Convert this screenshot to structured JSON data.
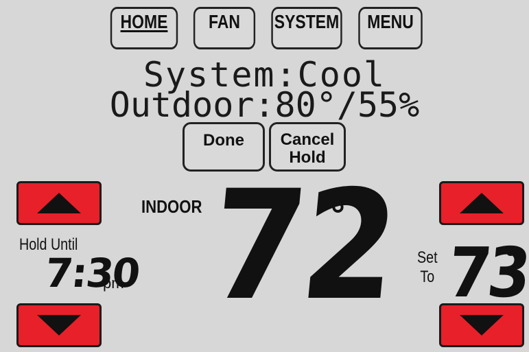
{
  "tabs": {
    "home": "HOME",
    "fan": "FAN",
    "system": "SYSTEM",
    "menu": "MENU"
  },
  "status": {
    "system_line": "System:Cool",
    "outdoor_line": "Outdoor:80°/55%"
  },
  "actions": {
    "done": "Done",
    "cancel_hold_line1": "Cancel",
    "cancel_hold_line2": "Hold"
  },
  "indoor": {
    "label": "INDOOR",
    "temperature": "72",
    "degree": "°"
  },
  "hold": {
    "label": "Hold Until",
    "time": "7:30",
    "ampm": "pm"
  },
  "setpoint": {
    "label_line1": "Set",
    "label_line2": "To",
    "temperature": "73",
    "degree": "°"
  },
  "icons": {
    "up": "up-arrow-icon",
    "down": "down-arrow-icon"
  },
  "colors": {
    "arrow_button": "#e8202a",
    "background": "#d7d7d7"
  }
}
